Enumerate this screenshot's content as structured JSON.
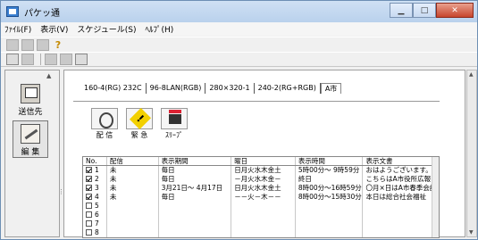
{
  "window": {
    "title": "パケッ通"
  },
  "menu": [
    "ﾌｧｲﾙ(F)",
    "表示(V)",
    "スケジュール(S)",
    "ﾍﾙﾌﾟ(H)"
  ],
  "left_panel": {
    "items": [
      {
        "label": "送信先"
      },
      {
        "label": "編 集"
      }
    ]
  },
  "tabs": [
    "160-4(RG) 232C",
    "96-8LAN(RGB)",
    "280×320-1",
    "240-2(RG+RGB)",
    "A市"
  ],
  "actions": [
    {
      "label": "配 信",
      "icon": "satellite-icon"
    },
    {
      "label": "緊 急",
      "icon": "warning-icon"
    },
    {
      "label": "ｽﾘｰﾌﾟ",
      "icon": "sleep-icon"
    }
  ],
  "table": {
    "headers": [
      "No.",
      "配信",
      "表示期間",
      "曜日",
      "表示時間",
      "表示文書"
    ],
    "rows": [
      {
        "checked": true,
        "no": "1",
        "hai": "未",
        "kikan": "毎日",
        "youbi": "日月火水木金土",
        "jikan": "5時00分～ 9時59分",
        "bun": "おはようございます。"
      },
      {
        "checked": true,
        "no": "2",
        "hai": "未",
        "kikan": "毎日",
        "youbi": "－月火水木金－",
        "jikan": "終日",
        "bun": "こちらはA市役所広報"
      },
      {
        "checked": true,
        "no": "3",
        "hai": "未",
        "kikan": "3月21日～ 4月17日",
        "youbi": "日月火水木金土",
        "jikan": "8時00分～16時59分",
        "bun": "〇月×日はA市春季会議"
      },
      {
        "checked": true,
        "no": "4",
        "hai": "未",
        "kikan": "毎日",
        "youbi": "－－火－木－－",
        "jikan": "8時00分～15時30分",
        "bun": "本日は総合社会福祉"
      },
      {
        "checked": false,
        "no": "5",
        "hai": "",
        "kikan": "",
        "youbi": "",
        "jikan": "",
        "bun": ""
      },
      {
        "checked": false,
        "no": "6",
        "hai": "",
        "kikan": "",
        "youbi": "",
        "jikan": "",
        "bun": ""
      },
      {
        "checked": false,
        "no": "7",
        "hai": "",
        "kikan": "",
        "youbi": "",
        "jikan": "",
        "bun": ""
      },
      {
        "checked": false,
        "no": "8",
        "hai": "",
        "kikan": "",
        "youbi": "",
        "jikan": "",
        "bun": ""
      }
    ]
  }
}
